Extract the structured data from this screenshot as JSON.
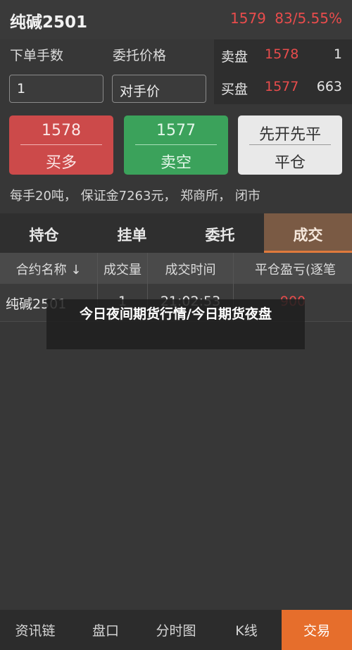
{
  "header": {
    "title": "纯碱2501",
    "price": "1579",
    "change": "83/5.55%"
  },
  "order": {
    "qty_label": "下单手数",
    "price_label": "委托价格",
    "qty_value": "1",
    "price_value": "对手价"
  },
  "book": {
    "ask": {
      "label": "卖盘",
      "price": "1578",
      "qty": "1"
    },
    "bid": {
      "label": "买盘",
      "price": "1577",
      "qty": "663"
    }
  },
  "buttons": {
    "buy": {
      "price": "1578",
      "label": "买多"
    },
    "sell": {
      "price": "1577",
      "label": "卖空"
    },
    "close": {
      "top": "先开先平",
      "label": "平仓"
    }
  },
  "info": "每手20吨， 保证金7263元， 郑商所， 闭市",
  "tabs": [
    "持仓",
    "挂单",
    "委托",
    "成交"
  ],
  "table": {
    "headers": [
      "合约名称 ↓",
      "成交量",
      "成交时间",
      "平仓盈亏(逐笔"
    ],
    "rows": [
      {
        "name": "纯碱2501",
        "volume": "1",
        "time": "21:02:53",
        "pnl": "900"
      }
    ]
  },
  "overlay_text": "今日夜间期货行情/今日期货夜盘",
  "colors": {
    "up": "#e84c4c",
    "down": "#3ba25b",
    "accent": "#e66e2c"
  },
  "bottom_nav": [
    "资讯链",
    "盘口",
    "分时图",
    "K线",
    "交易"
  ]
}
